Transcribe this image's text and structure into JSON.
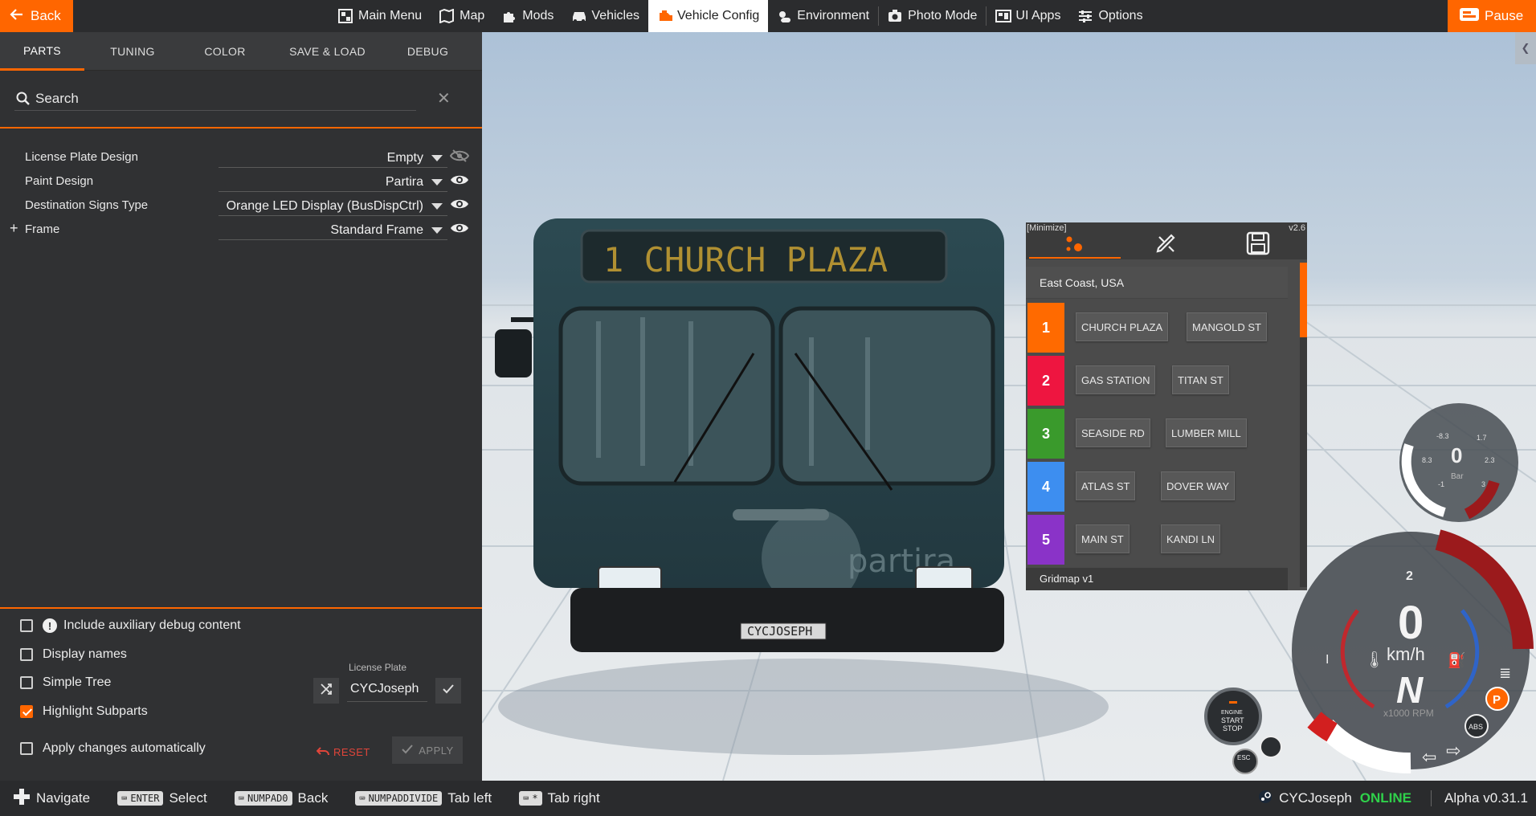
{
  "topbar": {
    "back_label": "Back",
    "pause_label": "Pause",
    "nav": [
      {
        "label": "Main Menu",
        "icon": "main-menu-icon"
      },
      {
        "label": "Map",
        "icon": "map-icon"
      },
      {
        "label": "Mods",
        "icon": "puzzle-icon"
      },
      {
        "label": "Vehicles",
        "icon": "car-icon"
      },
      {
        "label": "Vehicle Config",
        "icon": "engine-icon",
        "active": true
      },
      {
        "label": "Environment",
        "icon": "weather-icon"
      },
      {
        "label": "Photo Mode",
        "icon": "camera-icon"
      },
      {
        "label": "UI Apps",
        "icon": "ui-apps-icon"
      },
      {
        "label": "Options",
        "icon": "sliders-icon"
      }
    ]
  },
  "tabs": [
    "PARTS",
    "TUNING",
    "COLOR",
    "SAVE & LOAD",
    "DEBUG"
  ],
  "search": {
    "placeholder": "Search"
  },
  "parts": [
    {
      "name": "License Plate Design",
      "value": "Empty",
      "visible": false,
      "expandable": false
    },
    {
      "name": "Paint Design",
      "value": "Partira",
      "visible": true,
      "expandable": false
    },
    {
      "name": "Destination Signs Type",
      "value": "Orange LED Display (BusDispCtrl)",
      "visible": true,
      "expandable": false
    },
    {
      "name": "Frame",
      "value": "Standard Frame",
      "visible": true,
      "expandable": true
    }
  ],
  "options": {
    "auxiliary": {
      "label": "Include auxiliary debug content",
      "checked": false
    },
    "display_names": {
      "label": "Display names",
      "checked": false
    },
    "simple_tree": {
      "label": "Simple Tree",
      "checked": false
    },
    "highlight": {
      "label": "Highlight Subparts",
      "checked": true
    },
    "auto_apply": {
      "label": "Apply changes automatically",
      "checked": false
    }
  },
  "license_plate": {
    "label": "License Plate",
    "value": "CYCJoseph"
  },
  "buttons": {
    "reset": "RESET",
    "apply": "APPLY"
  },
  "bus_widget": {
    "minimize": "[Minimize]",
    "version": "v2.6",
    "region": "East Coast, USA",
    "footer": "Gridmap v1",
    "routes": [
      {
        "num": "1",
        "color": "#ff6a00",
        "stops": [
          "CHURCH PLAZA",
          "MANGOLD ST"
        ]
      },
      {
        "num": "2",
        "color": "#ee1540",
        "stops": [
          "GAS STATION",
          "TITAN ST"
        ]
      },
      {
        "num": "3",
        "color": "#3a9a2c",
        "stops": [
          "SEASIDE RD",
          "LUMBER MILL"
        ]
      },
      {
        "num": "4",
        "color": "#3d8ef0",
        "stops": [
          "ATLAS ST",
          "DOVER WAY"
        ]
      },
      {
        "num": "5",
        "color": "#8a33c8",
        "stops": [
          "MAIN ST",
          "KANDI LN"
        ]
      }
    ]
  },
  "scene": {
    "destination_sign": "1  CHURCH PLAZA",
    "plate_text": "CYCJOSEPH",
    "brand": "partira"
  },
  "gauges": {
    "boost_ticks": [
      "-8.3",
      "8.3",
      "1.7",
      "2.3",
      "-1",
      "3"
    ],
    "boost_value": "0",
    "boost_unit": "Bar",
    "gear_top": "2",
    "speed": "0",
    "speed_unit": "km/h",
    "gear": "N",
    "rpm_label": "x1000 RPM",
    "gear_left": "I",
    "engine_button": [
      "ENGINE",
      "START",
      "STOP"
    ],
    "esc": "ESC",
    "abs": "ABS",
    "parking": "P"
  },
  "hints": [
    {
      "key": "",
      "label": "Navigate"
    },
    {
      "key": "ENTER",
      "label": "Select"
    },
    {
      "key": "NUMPAD0",
      "label": "Back"
    },
    {
      "key": "NUMPADDIVIDE",
      "label": "Tab left"
    },
    {
      "key": "*",
      "label": "Tab right"
    }
  ],
  "user": {
    "name": "CYCJoseph",
    "status": "ONLINE",
    "version": "Alpha v0.31.1"
  },
  "colors": {
    "accent": "#ff6600",
    "online": "#2fd14a"
  }
}
